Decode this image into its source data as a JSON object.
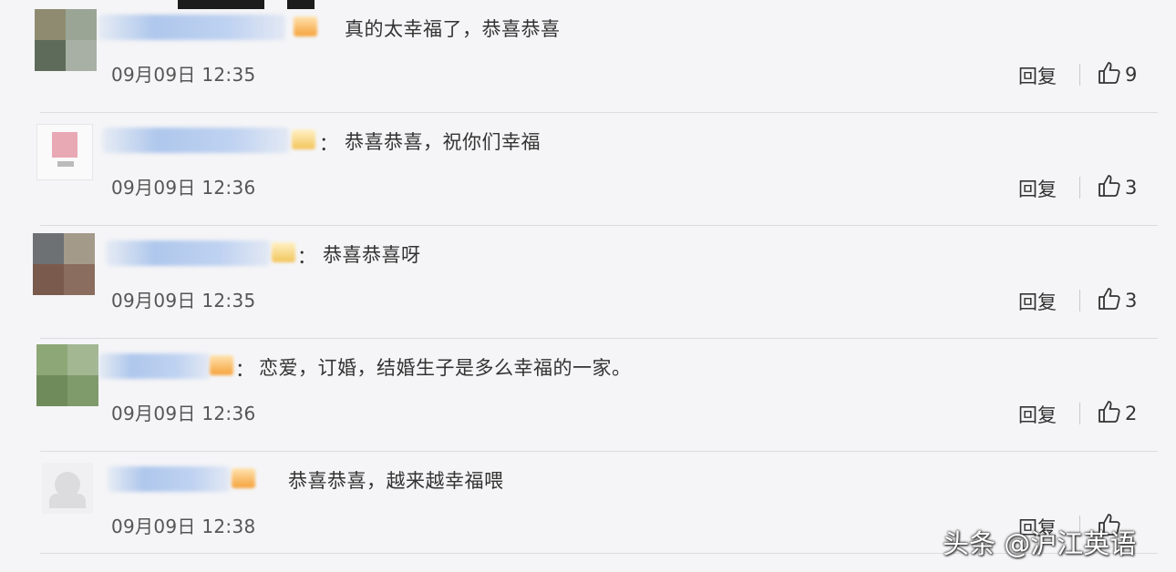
{
  "comments": [
    {
      "text": "真的太幸福了，恭喜恭喜",
      "time": "09月09日 12:35",
      "reply": "回复",
      "likes": "9",
      "colon": ""
    },
    {
      "text": "恭喜恭喜，祝你们幸福",
      "time": "09月09日 12:36",
      "reply": "回复",
      "likes": "3",
      "colon": "："
    },
    {
      "text": "恭喜恭喜呀",
      "time": "09月09日 12:35",
      "reply": "回复",
      "likes": "3",
      "colon": "："
    },
    {
      "text": "恋爱，订婚，结婚生子是多么幸福的一家。",
      "time": "09月09日 12:36",
      "reply": "回复",
      "likes": "2",
      "colon": "："
    },
    {
      "text": "恭喜恭喜，越来越幸福喂",
      "time": "09月09日 12:38",
      "reply": "回复",
      "likes": "",
      "colon": ""
    }
  ],
  "watermark": "头条 @沪江英语",
  "icons": {
    "like": "thumbs-up-icon"
  }
}
